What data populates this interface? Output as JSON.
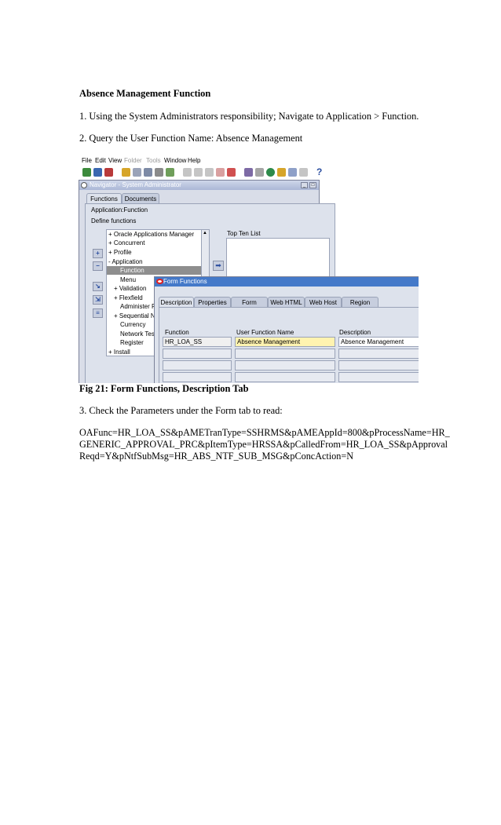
{
  "document": {
    "heading": "Absence Management Function",
    "step1": "1. Using the System Administrators responsibility; Navigate to Application > Function.",
    "step2": "2. Query the User Function Name: Absence Management",
    "caption": "Fig 21: Form Functions, Description Tab",
    "step3": "3. Check the Parameters under the Form tab to read:",
    "params_line1": "OAFunc=HR_LOA_SS&pAMETranType=SSHRMS&pAMEAppId=800&pProcessName=HR_",
    "params_line2": "GENERIC_APPROVAL_PRC&pItemType=HRSSA&pCalledFrom=HR_LOA_SS&pApproval",
    "params_line3": "Reqd=Y&pNtfSubMsg=HR_ABS_NTF_SUB_MSG&pConcAction=N"
  },
  "screenshot": {
    "menu": [
      "File",
      "Edit",
      "View",
      "Folder",
      "Tools",
      "Window",
      "Help"
    ],
    "navigator": {
      "title": "Navigator - System Administrator",
      "tabs": [
        "Functions",
        "Documents"
      ],
      "context": "Application:Function",
      "define_label": "Define functions",
      "top_ten_label": "Top Ten List",
      "tree": [
        "+ Oracle Applications Manager",
        "+ Concurrent",
        "+ Profile",
        "- Application",
        "Function",
        "Menu",
        "+ Validation",
        "+ Flexfield",
        "Administer F",
        "+ Sequential N",
        "Currency",
        "Network Tes",
        "Register",
        "+ Install"
      ]
    },
    "form_functions": {
      "title": "Form Functions",
      "tabs": [
        "Description",
        "Properties",
        "Form",
        "Web HTML",
        "Web Host",
        "Region"
      ],
      "columns": [
        "Function",
        "User Function Name",
        "Description"
      ],
      "row": [
        "HR_LOA_SS",
        "Absence Management",
        "Absence Management"
      ]
    },
    "colors": {
      "title_active": "#4479c9",
      "title_inactive": "#aab7d6",
      "selected_tree_item": "#8e8e8e",
      "current_field": "#fff3b0"
    }
  }
}
